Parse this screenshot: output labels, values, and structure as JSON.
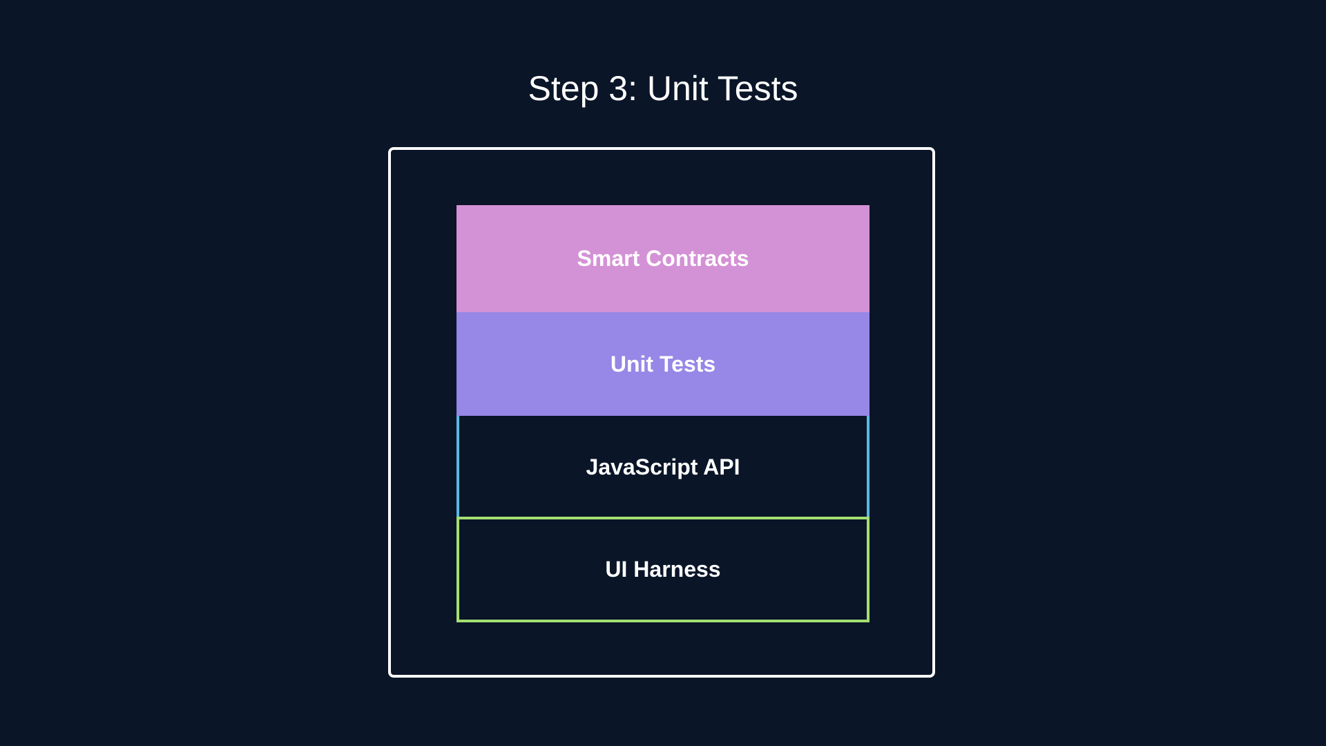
{
  "title": "Step 3: Unit Tests",
  "colors": {
    "background": "#0a1528",
    "frame": "#ffffff",
    "text": "#ffffff",
    "smart_contracts_fill": "#d492d6",
    "unit_tests_fill": "#9787e6",
    "javascript_api_border": "#5ab9e3",
    "ui_harness_border": "#a4df72"
  },
  "stack": {
    "layers": [
      {
        "label": "Smart Contracts"
      },
      {
        "label": "Unit Tests"
      },
      {
        "label": "JavaScript API"
      },
      {
        "label": "UI Harness"
      }
    ]
  }
}
